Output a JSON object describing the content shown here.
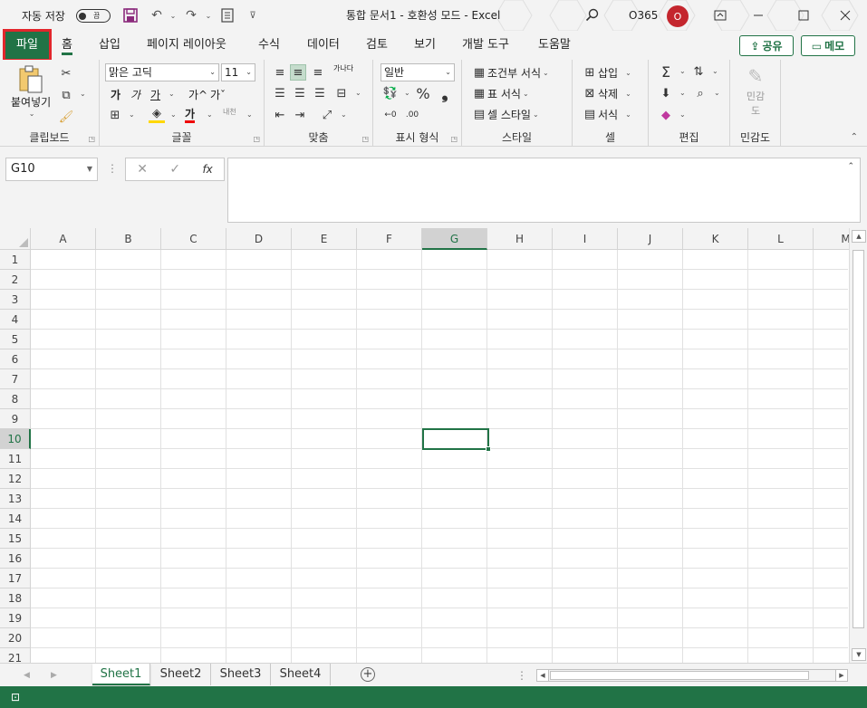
{
  "titlebar": {
    "autosave_label": "자동 저장",
    "autosave_state": "끔",
    "document_title": "통합 문서1  -  호환성 모드  -  Excel",
    "account_label": "O365",
    "avatar_initial": "O",
    "window_buttons": [
      "minimize",
      "restore",
      "close"
    ]
  },
  "tabs": {
    "items": [
      "파일",
      "홈",
      "삽입",
      "페이지 레이아웃",
      "수식",
      "데이터",
      "검토",
      "보기",
      "개발 도구",
      "도움말"
    ],
    "share_label": "공유",
    "memo_label": "메모"
  },
  "ribbon": {
    "clipboard": {
      "label": "클립보드",
      "paste": "붙여넣기"
    },
    "font": {
      "label": "글꼴",
      "font_name": "맑은 고딕",
      "font_size": "11",
      "bold": "가",
      "italic": "가",
      "underline": "가",
      "grow": "가^",
      "shrink": "가ˇ",
      "phonetic": "내천"
    },
    "alignment": {
      "label": "맞춤",
      "wrap": "가나다"
    },
    "number": {
      "label": "표시 형식",
      "format": "일반"
    },
    "styles": {
      "label": "스타일",
      "conditional": "조건부 서식",
      "table": "표 서식",
      "cell_styles": "셀 스타일"
    },
    "cells": {
      "label": "셀",
      "insert": "삽입",
      "delete": "삭제",
      "format": "서식"
    },
    "editing": {
      "label": "편집"
    },
    "sensitivity": {
      "label": "민감도",
      "button": "민감",
      "button2": "도"
    }
  },
  "formula_bar": {
    "name_box": "G10",
    "formula": ""
  },
  "grid": {
    "columns": [
      "A",
      "B",
      "C",
      "D",
      "E",
      "F",
      "G",
      "H",
      "I",
      "J",
      "K",
      "L",
      "M"
    ],
    "rows": [
      "1",
      "2",
      "3",
      "4",
      "5",
      "6",
      "7",
      "8",
      "9",
      "10",
      "11",
      "12",
      "13",
      "14",
      "15",
      "16",
      "17",
      "18",
      "19",
      "20",
      "21"
    ],
    "selected_column": "G",
    "selected_row": "10"
  },
  "sheets": {
    "tabs": [
      "Sheet1",
      "Sheet2",
      "Sheet3",
      "Sheet4"
    ],
    "active": "Sheet1"
  },
  "colors": {
    "accent": "#217346",
    "highlight_box": "#e3262c",
    "avatar": "#c4262e"
  }
}
